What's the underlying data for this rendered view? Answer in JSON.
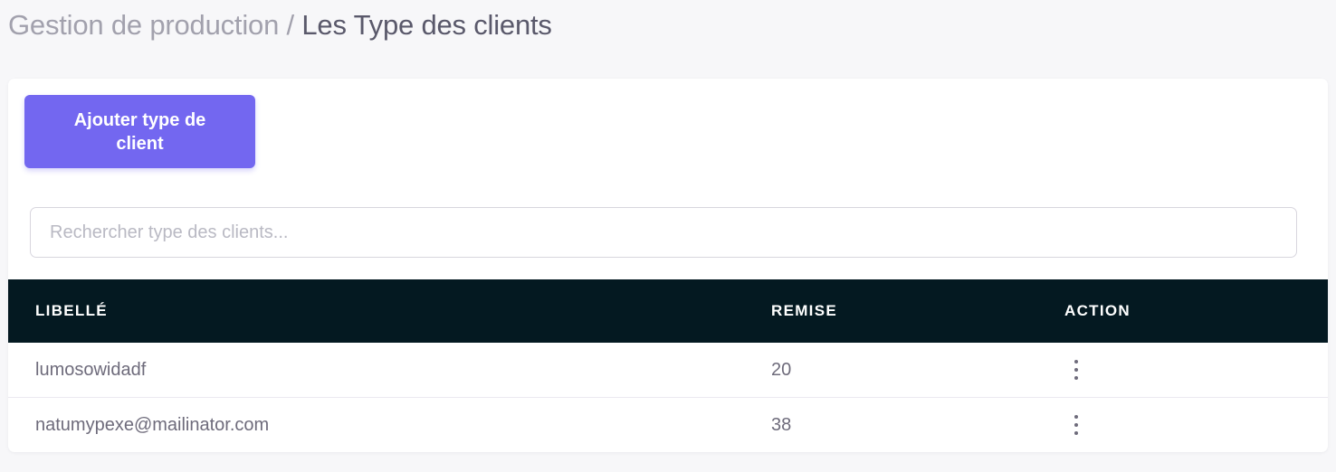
{
  "breadcrumb": {
    "parent": "Gestion de production",
    "separator": "/",
    "current": "Les Type des clients"
  },
  "actions": {
    "add_label": "Ajouter type de client"
  },
  "search": {
    "placeholder": "Rechercher type des clients...",
    "value": ""
  },
  "table": {
    "headers": [
      "LIBELLÉ",
      "REMISE",
      "ACTION"
    ],
    "rows": [
      {
        "libelle": "lumosowidadf",
        "remise": "20",
        "action_icon": "more-vertical-icon"
      },
      {
        "libelle": "natumypexe@mailinator.com",
        "remise": "38",
        "action_icon": "more-vertical-icon"
      }
    ]
  },
  "colors": {
    "page_background": "#f7f7f9",
    "primary": "#7367f0",
    "table_header": "#041921",
    "text": "#6e6b7b",
    "muted": "#a2a1ad"
  }
}
